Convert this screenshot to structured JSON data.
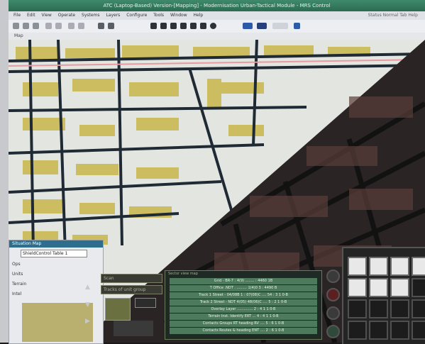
{
  "window": {
    "title": "ATC (Laptop-Based) Version-[Mapping] - Modernisation Urban-Tactical Module - MRS Control"
  },
  "menu": {
    "items": [
      "File",
      "Edit",
      "View",
      "Operate",
      "Systems",
      "Layers",
      "Configure",
      "Tools",
      "Window",
      "Help"
    ],
    "right_text": "Status Normal Tab Help"
  },
  "map_tab": {
    "label": "Map"
  },
  "side_panel": {
    "title": "Situation Map",
    "select_value": "ShieldControl Table 1",
    "labels": [
      "Ops",
      "Units",
      "Terrain",
      "Intel"
    ]
  },
  "hud": {
    "field1": "Scan",
    "field2": "Tracks of unit group",
    "info_caption": "Sector view map",
    "rows": [
      "Grid - BR-7 : 4(9) ........ : 4460 1B",
      "T Office .NDT . ......... 1(4)0 3 : 4490 B",
      "Track 1 Street - 04/08B  1 : 07(08)C ....  54 : 3 1 0-B",
      "Track 2 Street - NDT  4(05) 48(06)C ....  5 : 2 1 0-B",
      "Overlay Layer .............. 2 : 4 1 1 0-B",
      "Terrain Inst. Identify ERT ... 4 : 4 1 1 0-B",
      "Contacts Groups RT heading  RV .... 5 : 6 1 0-B",
      "Contacts Routes & heading  ENT .... 2 : 6 1 0-B"
    ]
  },
  "colors": {
    "map_bg": "#e3e6e0",
    "block_yellow": "#c9b84a",
    "road": "#1f2a35",
    "dark_bg": "#2b2424",
    "hud_green": "#4d7a5c"
  }
}
